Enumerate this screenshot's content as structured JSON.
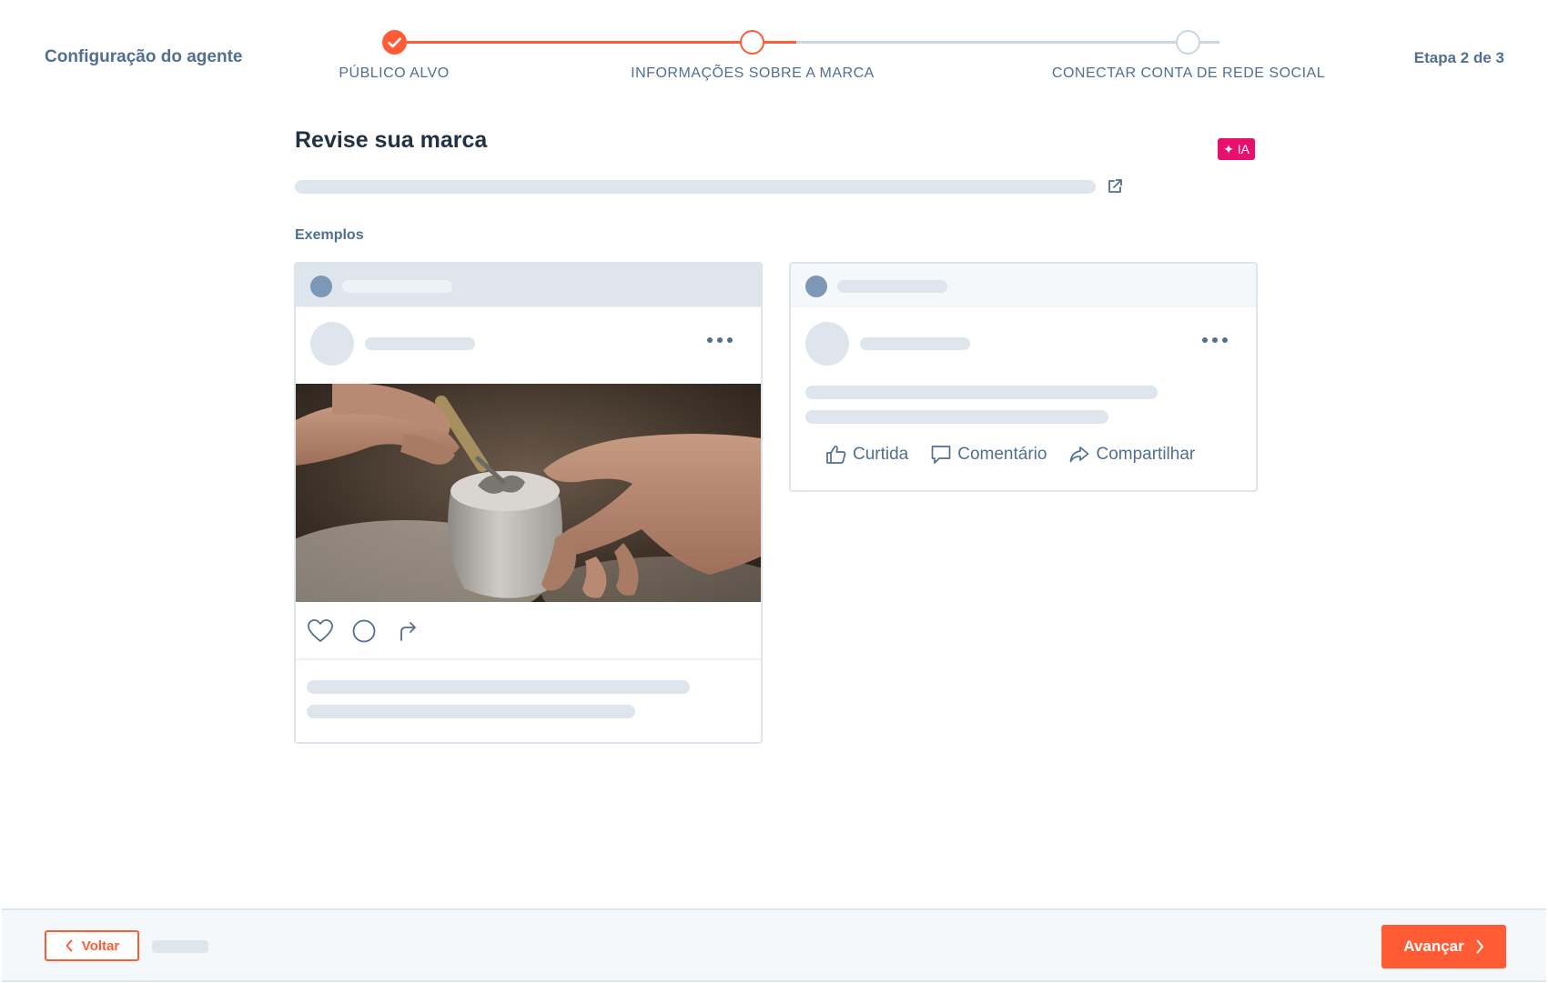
{
  "header": {
    "app_title": "Configuração do agente",
    "step_indicator": "Etapa 2 de 3"
  },
  "stepper": {
    "steps": [
      {
        "label": "PÚBLICO ALVO",
        "state": "complete"
      },
      {
        "label": "INFORMAÇÕES SOBRE A MARCA",
        "state": "active"
      },
      {
        "label": "CONECTAR CONTA DE REDE SOCIAL",
        "state": "pending"
      }
    ],
    "accent_color": "#ff5c35",
    "inactive_color": "#cbd6e2"
  },
  "main": {
    "title": "Revise sua marca",
    "ai_badge": "✦ IA",
    "external_link_icon": "external-link-icon",
    "examples_label": "Exemplos"
  },
  "instagram_preview": {
    "more_icon": "more-horizontal-icon",
    "image_icon": "pottery-photo",
    "action_icons": [
      "heart-icon",
      "comment-icon",
      "share-arrow-icon"
    ]
  },
  "facebook_preview": {
    "more_icon": "more-horizontal-icon",
    "actions": [
      {
        "label": "Curtida",
        "icon": "thumbs-up-icon"
      },
      {
        "label": "Comentário",
        "icon": "comment-bubble-icon"
      },
      {
        "label": "Compartilhar",
        "icon": "share-icon"
      }
    ]
  },
  "footer": {
    "back_label": "Voltar",
    "next_label": "Avançar",
    "back_icon": "chevron-left-icon",
    "next_icon": "chevron-right-icon"
  },
  "colors": {
    "accent": "#ff5c35",
    "ai_badge": "#e8106e",
    "text_secondary": "#516f90",
    "skeleton": "#dfe5ed"
  }
}
